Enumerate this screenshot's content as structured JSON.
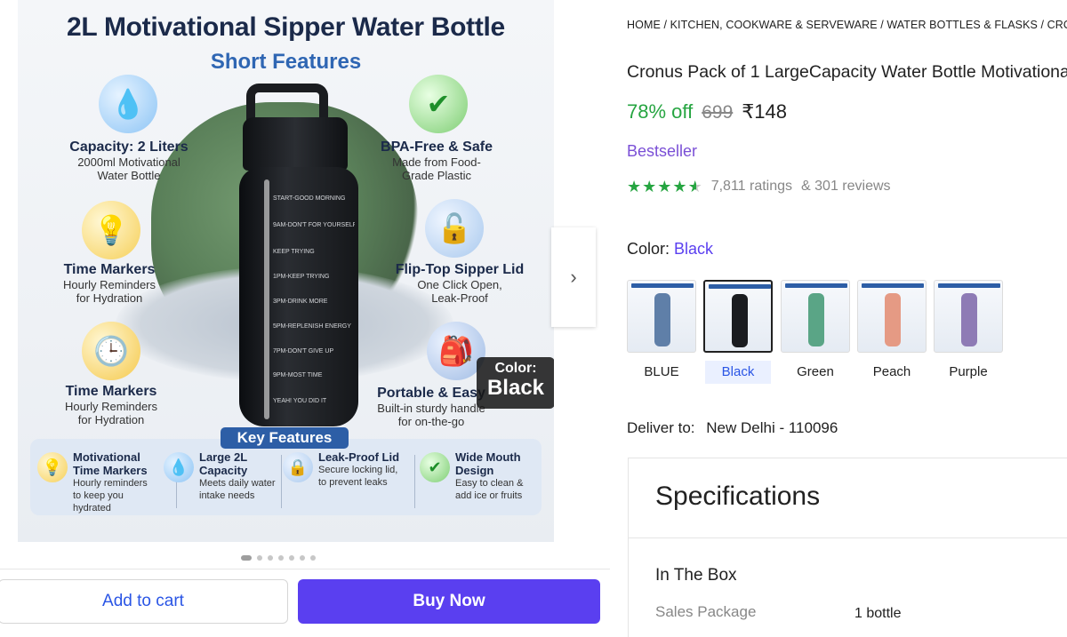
{
  "hero": {
    "title": "2L Motivational Sipper Water Bottle",
    "subtitle": "Short Features",
    "bottle_marks": [
      "START-GOOD MORNING",
      "9AM-DON'T FOR YOURSELF",
      "KEEP TRYING",
      "1PM-KEEP TRYING",
      "3PM-DRINK MORE",
      "5PM-REPLENISH ENERGY",
      "7PM-DON'T GIVE UP",
      "9PM-MOST TIME",
      "YEAH! YOU DID IT"
    ],
    "features": [
      {
        "title": "Capacity: 2 Liters",
        "lines": [
          "2000ml Motivational",
          "Water Bottle"
        ],
        "icon": "water-drop-icon"
      },
      {
        "title": "BPA-Free & Safe",
        "lines": [
          "Made from Food-",
          "Grade Plastic"
        ],
        "icon": "checkmark-icon"
      },
      {
        "title": "Time Markers",
        "lines": [
          "Hourly Reminders",
          "for Hydration"
        ],
        "icon": "lightbulb-icon"
      },
      {
        "title": "Flip-Top Sipper Lid",
        "lines": [
          "One Click Open,",
          "Leak-Proof"
        ],
        "icon": "lid-icon"
      },
      {
        "title": "Time Markers",
        "lines": [
          "Hourly Reminders",
          "for Hydration"
        ],
        "icon": "clock-icon"
      },
      {
        "title": "Portable & Easy",
        "lines": [
          "Built-in sturdy handle",
          "for on-the-go"
        ],
        "icon": "bag-icon"
      }
    ],
    "color_tag": {
      "label": "Color:",
      "value": "Black"
    },
    "key_features_title": "Key Features",
    "key_features": [
      {
        "title": "Motivational Time Markers",
        "lines": [
          "Hourly reminders",
          "to keep you hydrated"
        ],
        "icon": "bulb-icon"
      },
      {
        "title": "Large 2L Capacity",
        "lines": [
          "Meets daily water",
          "intake needs"
        ],
        "icon": "drop-icon"
      },
      {
        "title": "Leak-Proof Lid",
        "lines": [
          "Secure locking lid,",
          "to prevent leaks"
        ],
        "icon": "lock-icon"
      },
      {
        "title": "Wide Mouth Design",
        "lines": [
          "Easy to clean &",
          "add ice or fruits"
        ],
        "icon": "check-icon"
      }
    ]
  },
  "carousel": {
    "dots": 7,
    "active": 0,
    "next_icon": "chevron-right-icon"
  },
  "actions": {
    "add_to_cart": "Add to cart",
    "buy_now": "Buy Now"
  },
  "breadcrumb": "HOME / KITCHEN, COOKWARE & SERVEWARE / WATER BOTTLES & FLASKS / CRONUS",
  "product": {
    "title": "Cronus Pack of 1 LargeCapacity Water Bottle Motivational",
    "discount": "78% off",
    "mrp": "699",
    "price": "₹148",
    "badge": "Bestseller",
    "rating": {
      "stars": 4.5,
      "count": "7,811 ratings",
      "reviews": "& 301 reviews"
    }
  },
  "color": {
    "label": "Color:",
    "selected": "Black",
    "options": [
      {
        "label": "BLUE",
        "hex": "#5f7fa8"
      },
      {
        "label": "Black",
        "hex": "#1a1c20"
      },
      {
        "label": "Green",
        "hex": "#5aa586"
      },
      {
        "label": "Peach",
        "hex": "#e59a84"
      },
      {
        "label": "Purple",
        "hex": "#8e7bb5"
      }
    ]
  },
  "delivery": {
    "label": "Deliver to:",
    "location": "New Delhi - 110096"
  },
  "specs": {
    "heading": "Specifications",
    "section": "In The Box",
    "rows": [
      {
        "key": "Sales Package",
        "value": "1 bottle"
      }
    ]
  },
  "colors": {
    "accent": "#5a3ff0",
    "link": "#2a55e5",
    "discount": "#26a541",
    "badge": "#7a4fd6"
  }
}
